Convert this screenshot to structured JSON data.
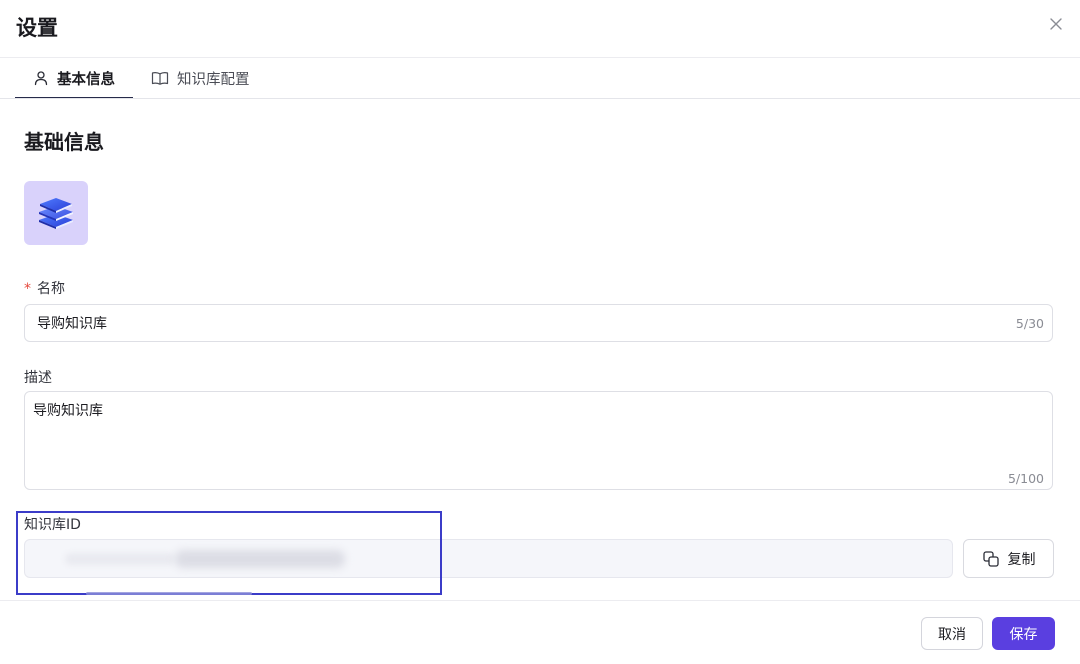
{
  "dialog": {
    "title": "设置"
  },
  "tabs": [
    {
      "label": "基本信息",
      "icon": "user-icon",
      "active": true
    },
    {
      "label": "知识库配置",
      "icon": "book-icon",
      "active": false
    }
  ],
  "section": {
    "title": "基础信息",
    "avatar_icon": "books-stack-icon",
    "avatar_bg": "#d9d2fb"
  },
  "fields": {
    "name": {
      "required_mark": "*",
      "label": "名称",
      "value": "导购知识库",
      "counter": "5/30"
    },
    "description": {
      "label": "描述",
      "value": "导购知识库",
      "counter": "5/100"
    },
    "kb_id": {
      "label": "知识库ID",
      "value": "",
      "copy_label": "复制"
    }
  },
  "footer": {
    "cancel_label": "取消",
    "save_label": "保存"
  },
  "colors": {
    "accent": "#5a3fe0",
    "highlight": "#3b3cc8",
    "required": "#e5483c"
  }
}
